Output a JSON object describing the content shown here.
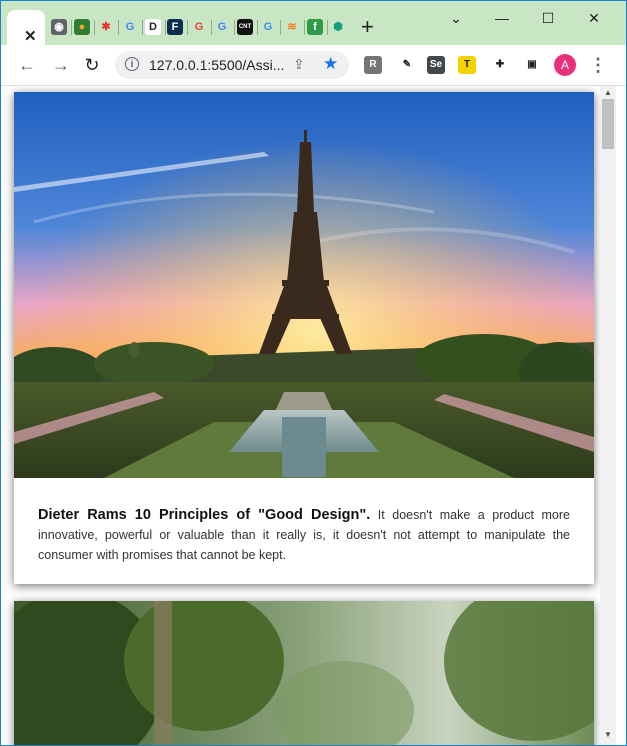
{
  "tabs": {
    "active_close": "✕",
    "icons": [
      {
        "name": "globe-icon",
        "glyph": "◉",
        "bg": "#5f6368",
        "fg": "#ffffff"
      },
      {
        "name": "earth-icon",
        "glyph": "●",
        "bg": "#2e7d32",
        "fg": "#f9a825"
      },
      {
        "name": "asterisk-icon",
        "glyph": "✱",
        "bg": "transparent",
        "fg": "#e53935"
      },
      {
        "name": "google-icon",
        "glyph": "G",
        "bg": "transparent",
        "fg": "#4285f4"
      },
      {
        "name": "d-logo-icon",
        "glyph": "D",
        "bg": "#ffffff",
        "fg": "#222222"
      },
      {
        "name": "f-logo-icon",
        "glyph": "F",
        "bg": "#0b2e4f",
        "fg": "#ffffff"
      },
      {
        "name": "google-color-icon",
        "glyph": "G",
        "bg": "transparent",
        "fg": "#ea4335"
      },
      {
        "name": "google-icon-2",
        "glyph": "G",
        "bg": "transparent",
        "fg": "#4285f4"
      },
      {
        "name": "cnt-logo-icon",
        "glyph": "CNT",
        "bg": "#111111",
        "fg": "#ffffff"
      },
      {
        "name": "google-icon-3",
        "glyph": "G",
        "bg": "transparent",
        "fg": "#4285f4"
      },
      {
        "name": "stack-icon",
        "glyph": "≋",
        "bg": "transparent",
        "fg": "#f48024"
      },
      {
        "name": "f-circle-icon",
        "glyph": "f",
        "bg": "#2e9b47",
        "fg": "#ffffff"
      },
      {
        "name": "hex-icon",
        "glyph": "⬢",
        "bg": "transparent",
        "fg": "#10a37f"
      }
    ],
    "new_tab": "+"
  },
  "window_controls": {
    "chevron": "⌄",
    "minimize": "—",
    "maximize": "☐",
    "close": "✕"
  },
  "toolbar": {
    "back": "←",
    "forward": "→",
    "reload": "↻",
    "info": "i",
    "url": "127.0.0.1:5500/Assi...",
    "share": "⇪",
    "star": "★",
    "extensions": [
      {
        "name": "r-extension-icon",
        "glyph": "R",
        "bg": "#757575",
        "fg": "#ffffff"
      },
      {
        "name": "eyedropper-extension-icon",
        "glyph": "✎",
        "bg": "transparent",
        "fg": "#202124"
      },
      {
        "name": "selenium-extension-icon",
        "glyph": "Se",
        "bg": "#43474a",
        "fg": "#ffffff"
      },
      {
        "name": "t-extension-icon",
        "glyph": "T",
        "bg": "#f5d300",
        "fg": "#202124"
      },
      {
        "name": "puzzle-extensions-icon",
        "glyph": "✚",
        "bg": "transparent",
        "fg": "#202124"
      },
      {
        "name": "sidepanel-icon",
        "glyph": "▣",
        "bg": "transparent",
        "fg": "#202124"
      }
    ],
    "avatar_letter": "A",
    "menu": "⋮"
  },
  "content": {
    "card1": {
      "caption_title": "Dieter Rams 10 Principles of \"Good Design\".",
      "caption_body": " It doesn't make a product more innovative, powerful or valuable than it really is, it doesn't not attempt to manipulate the consumer with promises that cannot be kept."
    }
  },
  "scrollbar": {
    "up": "▲",
    "down": "▼"
  }
}
